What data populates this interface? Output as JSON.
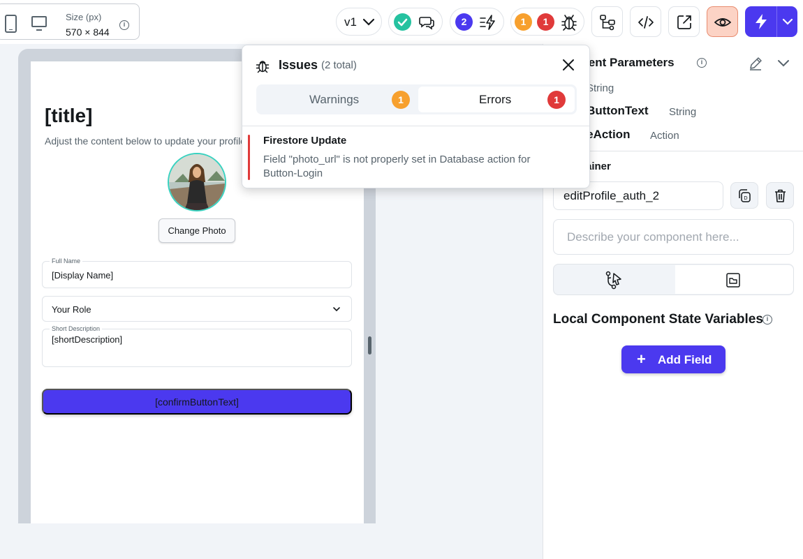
{
  "toolbar": {
    "size_label": "Size (px)",
    "size_value": "570 × 844",
    "version": "v1",
    "bolt_count": "2",
    "warning_count": "1",
    "error_count": "1"
  },
  "preview": {
    "title": "[title]",
    "subtitle": "Adjust the content below to update your profile.",
    "change_photo": "Change Photo",
    "full_name_label": "Full Name",
    "full_name_value": "[Display Name]",
    "role_value": "Your Role",
    "short_desc_label": "Short Description",
    "short_desc_value": "[shortDescription]",
    "confirm_button": "[confirmButtonText]"
  },
  "panel": {
    "title": "onent Parameters",
    "params": [
      {
        "name": "",
        "type": "String"
      },
      {
        "name": "mButtonText",
        "type": "String"
      },
      {
        "name": "ateAction",
        "type": "Action"
      }
    ],
    "container_label": "tainer",
    "component_name": "editProfile_auth_2",
    "description_placeholder": "Describe your component here...",
    "state_title": "Local Component State Variables",
    "add_field": "Add Field"
  },
  "issues": {
    "title": "Issues",
    "count": "(2 total)",
    "tab_warnings": "Warnings",
    "tab_errors": "Errors",
    "warnings_badge": "1",
    "errors_badge": "1",
    "error_title": "Firestore Update",
    "error_message": "Field \"photo_url\" is not properly set in Database action for Button-Login"
  },
  "colors": {
    "primary": "#4b39ef",
    "success": "#25c2a0",
    "warning": "#f7a02e",
    "error": "#e03a3a",
    "preview_active": "#fcd3c5"
  }
}
